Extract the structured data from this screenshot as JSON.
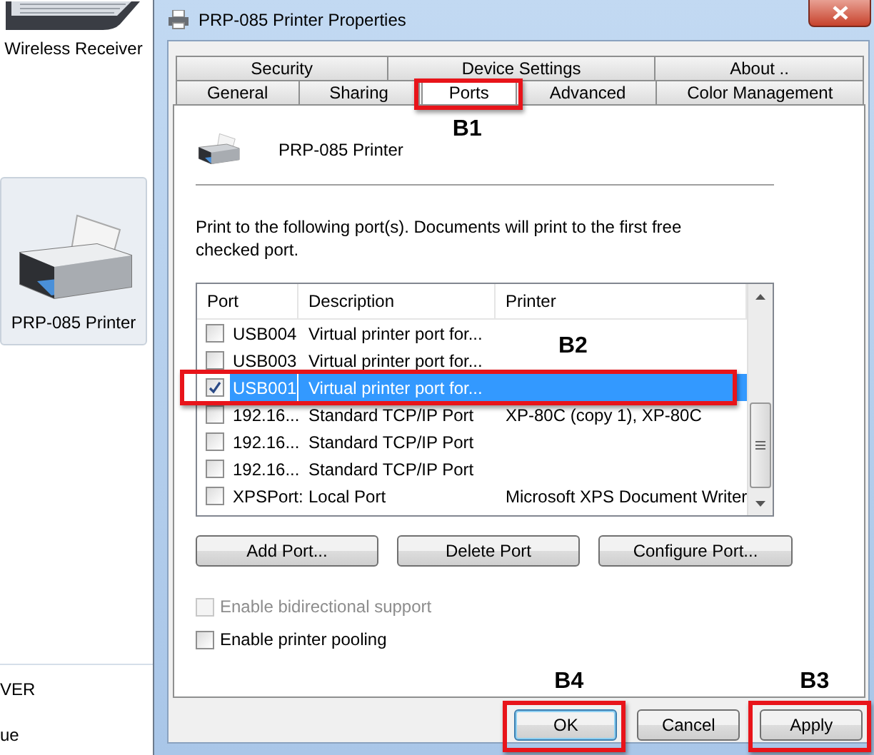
{
  "left_pane": {
    "items": [
      {
        "kind": "receiver",
        "label": "Wireless Receiver",
        "selected": false
      },
      {
        "kind": "printer",
        "label": "PRP-085 Printer",
        "selected": true
      }
    ],
    "footer_texts": [
      "VER",
      "ue"
    ]
  },
  "window": {
    "title": "PRP-085 Printer Properties"
  },
  "tab_rows": [
    [
      {
        "label": "Security",
        "selected": false
      },
      {
        "label": "Device Settings",
        "selected": false
      },
      {
        "label": "About ..",
        "selected": false
      }
    ],
    [
      {
        "label": "General",
        "selected": false
      },
      {
        "label": "Sharing",
        "selected": false
      },
      {
        "label": "Ports",
        "selected": true,
        "annotation": "B1"
      },
      {
        "label": "Advanced",
        "selected": false
      },
      {
        "label": "Color Management",
        "selected": false
      }
    ]
  ],
  "printer_name": "PRP-085 Printer",
  "instructions": "Print to the following port(s). Documents will print to the first free checked port.",
  "ports_table": {
    "columns": [
      "Port",
      "Description",
      "Printer"
    ],
    "rows": [
      {
        "port": "USB004",
        "description": "Virtual printer port for...",
        "checked": false,
        "selected": false
      },
      {
        "port": "USB003",
        "description": "Virtual printer port for...",
        "checked": false,
        "selected": false
      },
      {
        "port": "USB001",
        "description": "Virtual printer port for...",
        "checked": true,
        "selected": true,
        "annotation": "B2"
      },
      {
        "port": "192.16...",
        "description": "Standard TCP/IP Port",
        "printer": "XP-80C (copy 1), XP-80C",
        "checked": false,
        "selected": false
      },
      {
        "port": "192.16...",
        "description": "Standard TCP/IP Port",
        "checked": false,
        "selected": false
      },
      {
        "port": "192.16...",
        "description": "Standard TCP/IP Port",
        "checked": false,
        "selected": false
      },
      {
        "port": "XPSPort:",
        "description": "Local Port",
        "printer": "Microsoft XPS Document Writer",
        "checked": false,
        "selected": false
      }
    ]
  },
  "port_buttons": [
    "Add Port...",
    "Delete Port",
    "Configure Port..."
  ],
  "options": [
    {
      "label": "Enable bidirectional support",
      "checked": false,
      "disabled": true
    },
    {
      "label": "Enable printer pooling",
      "checked": false,
      "disabled": false
    }
  ],
  "dialog_buttons": [
    {
      "label": "OK",
      "default": true,
      "annotation": "B4"
    },
    {
      "label": "Cancel",
      "default": false
    },
    {
      "label": "Apply",
      "default": false,
      "annotation": "B3"
    }
  ]
}
